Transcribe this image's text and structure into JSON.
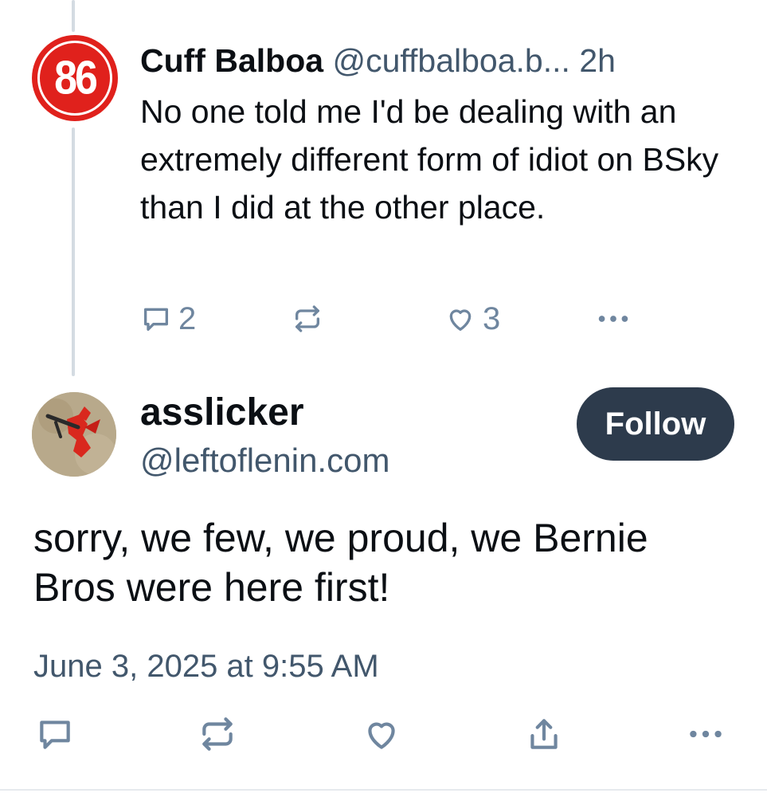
{
  "parent_post": {
    "avatar_text": "86",
    "avatar_color": "#e0211c",
    "display_name": "Cuff Balboa",
    "handle": "@cuffbalboa.b...",
    "time": "2h",
    "text": "No one told me I'd be dealing with an extremely different form of idiot on BSky than I did at the other place.",
    "reply_count": "2",
    "like_count": "3",
    "icons": [
      "reply-icon",
      "repost-icon",
      "like-icon",
      "more-icon"
    ]
  },
  "main_post": {
    "display_name": "asslicker",
    "handle": "@leftoflenin.com",
    "follow_label": "Follow",
    "text": "sorry, we few, we proud, we Bernie Bros were here first!",
    "timestamp": "June 3, 2025 at 9:55 AM",
    "icons": [
      "reply-icon",
      "repost-icon",
      "like-icon",
      "share-icon",
      "more-icon"
    ]
  },
  "colors": {
    "text": "#0b0f14",
    "muted": "#42576c",
    "icon": "#6f869f",
    "follow_bg": "#2d3b4c",
    "thread_line": "#d4dbe2"
  }
}
